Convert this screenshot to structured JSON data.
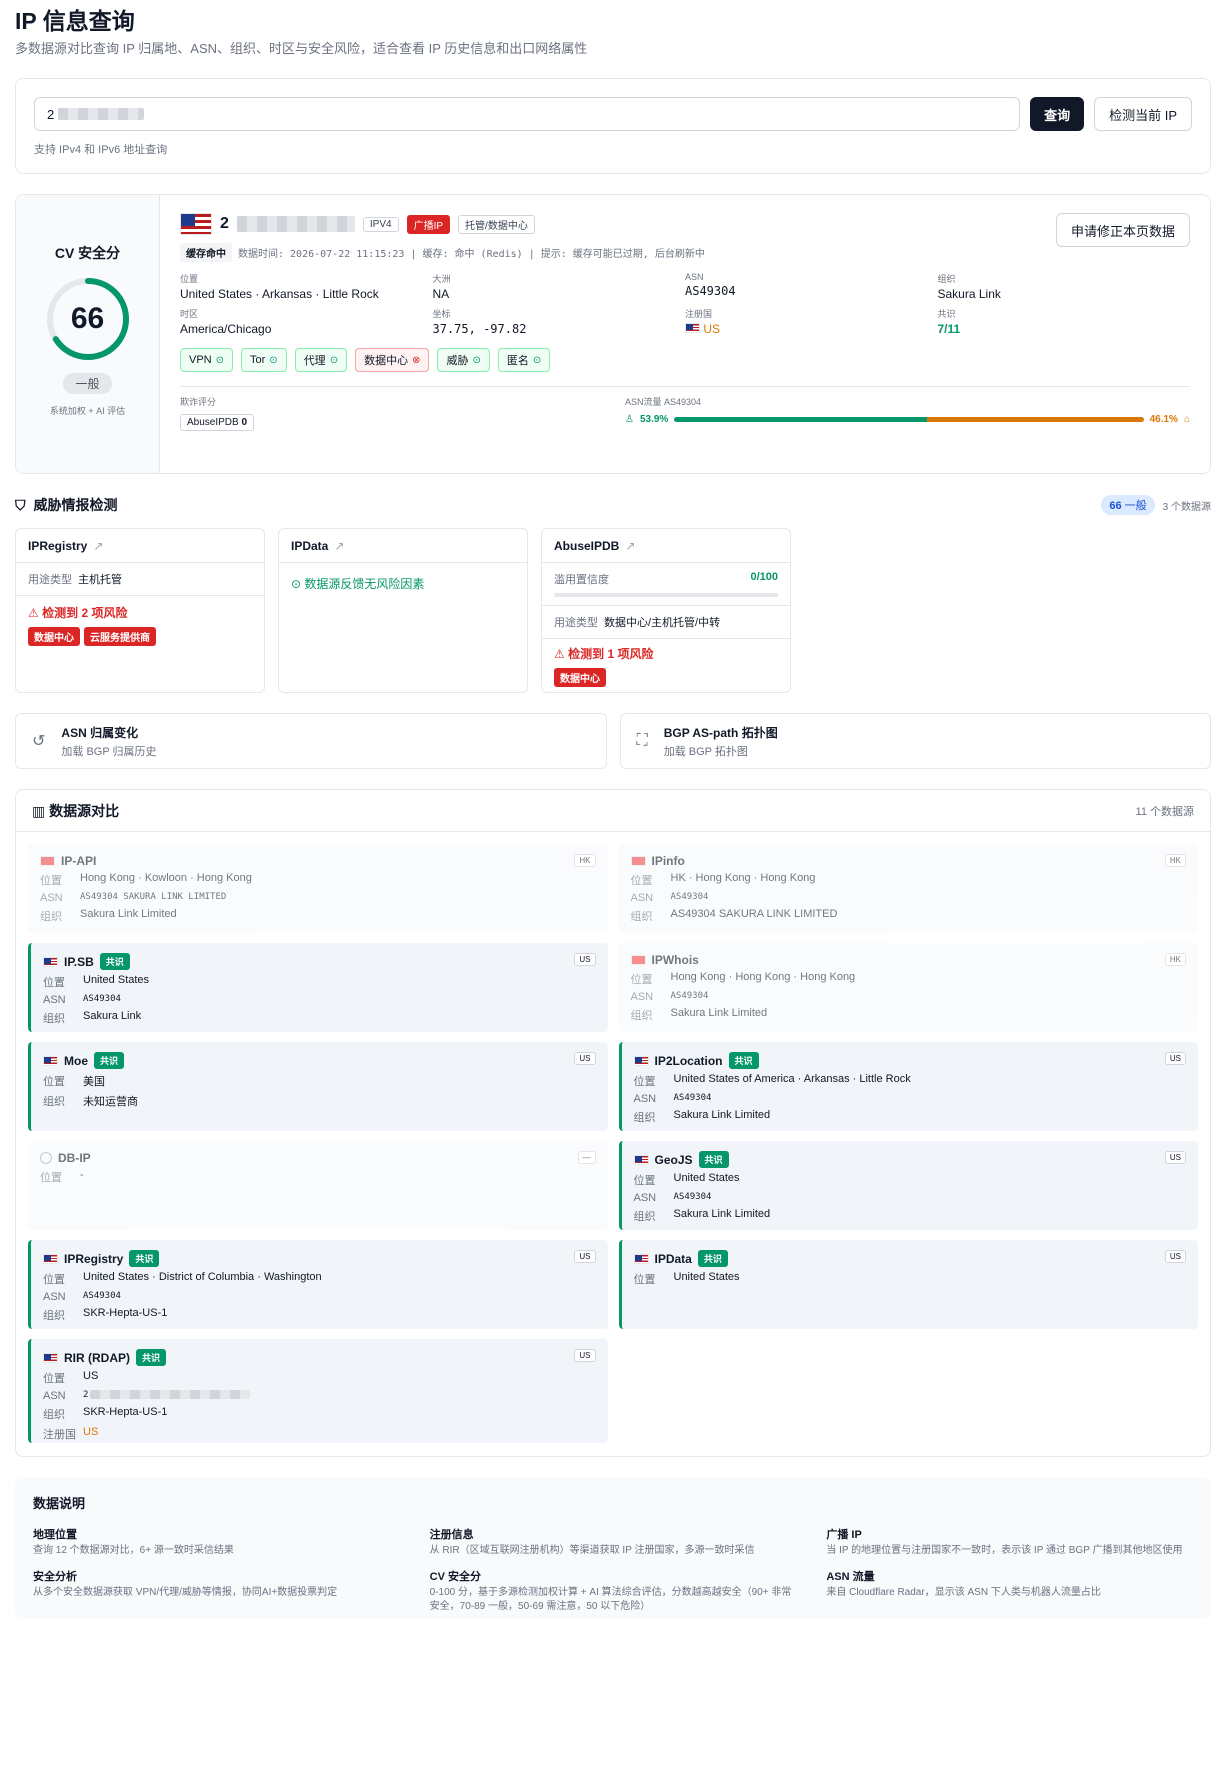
{
  "header": {
    "title": "IP 信息查询",
    "subtitle": "多数据源对比查询 IP 归属地、ASN、组织、时区与安全风险，适合查看 IP 历史信息和出口网络属性"
  },
  "search": {
    "value_prefix": "2",
    "query_label": "查询",
    "detect_label": "检测当前 IP",
    "hint": "支持 IPv4 和 IPv6 地址查询"
  },
  "score": {
    "label": "CV 安全分",
    "value": "66",
    "progress": 0.66,
    "level": "一般",
    "note": "系统加权 + AI 评估"
  },
  "ip": {
    "prefix": "2",
    "version": "IPV4",
    "broadcast": "广播IP",
    "hosting": "托管/数据中心",
    "correct_label": "申请修正本页数据",
    "cache": "缓存命中",
    "meta": "数据时间: 2026-07-22 11:15:23 | 缓存: 命中 (Redis) | 提示: 缓存可能已过期, 后台刷新中"
  },
  "fields": {
    "loc_k": "位置",
    "loc_v": "United States · Arkansas · Little Rock",
    "cont_k": "大洲",
    "cont_v": "NA",
    "asn_k": "ASN",
    "asn_v": "AS49304",
    "org_k": "组织",
    "org_v": "Sakura Link",
    "tz_k": "时区",
    "tz_v": "America/Chicago",
    "coord_k": "坐标",
    "coord_v": "37.75, -97.82",
    "reg_k": "注册国",
    "reg_v": "US",
    "cons_k": "共识",
    "cons_v": "7/11"
  },
  "chips": [
    {
      "label": "VPN",
      "bad": false
    },
    {
      "label": "Tor",
      "bad": false
    },
    {
      "label": "代理",
      "bad": false
    },
    {
      "label": "数据中心",
      "bad": true
    },
    {
      "label": "威胁",
      "bad": false
    },
    {
      "label": "匿名",
      "bad": false
    }
  ],
  "fraud": {
    "label": "欺诈评分",
    "src": "AbuseIPDB",
    "val": "0"
  },
  "traffic": {
    "label": "ASN流量 AS49304",
    "human": "53.9%",
    "bot": "46.1%",
    "human_frac": 0.539
  },
  "threat": {
    "title": "威胁情报检测",
    "score": "66",
    "level": "一般",
    "count": "3 个数据源",
    "c1": {
      "name": "IPRegistry",
      "type_k": "用途类型",
      "type_v": "主机托管",
      "risk": "检测到 2 项风险",
      "tags": [
        "数据中心",
        "云服务提供商"
      ]
    },
    "c2": {
      "name": "IPData",
      "ok": "数据源反馈无风险因素"
    },
    "c3": {
      "name": "AbuseIPDB",
      "abuse_k": "滥用置信度",
      "abuse_v": "0/100",
      "type_k": "用途类型",
      "type_v": "数据中心/主机托管/中转",
      "risk": "检测到 1 项风险",
      "tags": [
        "数据中心"
      ]
    }
  },
  "extra": {
    "asn_t": "ASN 归属变化",
    "asn_s": "加载 BGP 归属历史",
    "bgp_t": "BGP AS-path 拓扑图",
    "bgp_s": "加载 BGP 拓扑图"
  },
  "compare": {
    "title": "数据源对比",
    "count": "11 个数据源",
    "consensus": "共识",
    "ipapi": {
      "name": "IP-API",
      "cc": "HK",
      "loc": "Hong Kong · Kowloon · Hong Kong",
      "asn": "AS49304 SAKURA LINK LIMITED",
      "org": "Sakura Link Limited"
    },
    "ipinfo": {
      "name": "IPinfo",
      "cc": "HK",
      "loc": "HK · Hong Kong · Hong Kong",
      "asn": "AS49304",
      "org": "AS49304 SAKURA LINK LIMITED"
    },
    "ipsb": {
      "name": "IP.SB",
      "cc": "US",
      "loc": "United States",
      "asn": "AS49304",
      "org": "Sakura Link"
    },
    "ipwhois": {
      "name": "IPWhois",
      "cc": "HK",
      "loc": "Hong Kong · Hong Kong · Hong Kong",
      "asn": "AS49304",
      "org": "Sakura Link Limited"
    },
    "moe": {
      "name": "Moe",
      "cc": "US",
      "loc": "美国",
      "org": "未知运营商"
    },
    "ip2l": {
      "name": "IP2Location",
      "cc": "US",
      "loc": "United States of America · Arkansas · Little Rock",
      "asn": "AS49304",
      "org": "Sakura Link Limited"
    },
    "dbip": {
      "name": "DB-IP",
      "cc": "—",
      "loc": "-"
    },
    "geojs": {
      "name": "GeoJS",
      "cc": "US",
      "loc": "United States",
      "asn": "AS49304",
      "org": "Sakura Link Limited"
    },
    "ipreg": {
      "name": "IPRegistry",
      "cc": "US",
      "loc": "United States · District of Columbia · Washington",
      "asn": "AS49304",
      "org": "SKR-Hepta-US-1"
    },
    "ipdata": {
      "name": "IPData",
      "cc": "US",
      "loc": "United States"
    },
    "rir": {
      "name": "RIR (RDAP)",
      "cc": "US",
      "loc": "US",
      "asn": "2",
      "org": "SKR-Hepta-US-1",
      "reg": "US"
    },
    "k_loc": "位置",
    "k_asn": "ASN",
    "k_org": "组织",
    "k_reg": "注册国"
  },
  "notes": {
    "title": "数据说明",
    "items": [
      {
        "h": "地理位置",
        "d": "查询 12 个数据源对比，6+ 源一致时采信结果"
      },
      {
        "h": "注册信息",
        "d": "从 RIR（区域互联网注册机构）等渠道获取 IP 注册国家，多源一致时采信"
      },
      {
        "h": "广播 IP",
        "d": "当 IP 的地理位置与注册国家不一致时，表示该 IP 通过 BGP 广播到其他地区使用"
      },
      {
        "h": "安全分析",
        "d": "从多个安全数据源获取 VPN/代理/威胁等情报，协同AI+数据投票判定"
      },
      {
        "h": "CV 安全分",
        "d": "0-100 分，基于多源检测加权计算 + AI 算法综合评估，分数越高越安全（90+ 非常安全，70-89 一般，50-69 需注意，50 以下危险）"
      },
      {
        "h": "ASN 流量",
        "d": "来自 Cloudflare Radar，显示该 ASN 下人类与机器人流量占比"
      }
    ]
  }
}
